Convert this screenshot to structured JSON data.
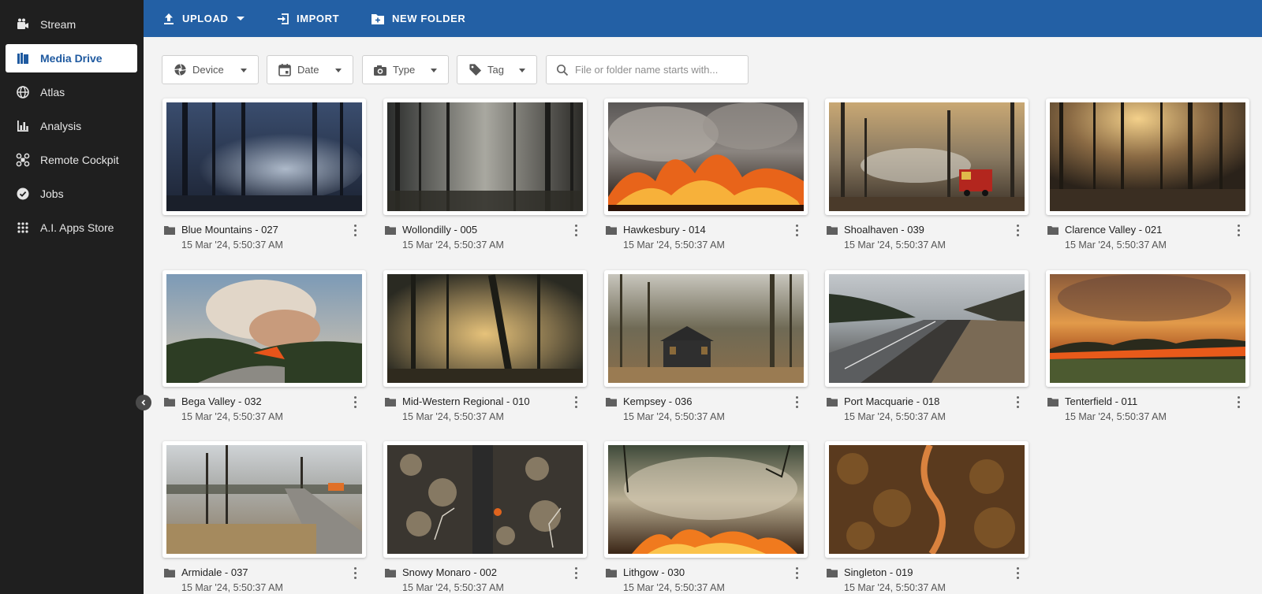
{
  "sidebar": {
    "items": [
      {
        "label": "Stream",
        "icon": "video-camera-icon",
        "active": false
      },
      {
        "label": "Media Drive",
        "icon": "media-library-icon",
        "active": true
      },
      {
        "label": "Atlas",
        "icon": "globe-icon",
        "active": false
      },
      {
        "label": "Analysis",
        "icon": "bar-chart-icon",
        "active": false
      },
      {
        "label": "Remote Cockpit",
        "icon": "drone-icon",
        "active": false
      },
      {
        "label": "Jobs",
        "icon": "check-circle-icon",
        "active": false
      },
      {
        "label": "A.I. Apps Store",
        "icon": "apps-grid-icon",
        "active": false
      }
    ]
  },
  "toolbar": {
    "upload_label": "UPLOAD",
    "import_label": "IMPORT",
    "new_folder_label": "NEW FOLDER"
  },
  "filters": {
    "device_label": "Device",
    "date_label": "Date",
    "type_label": "Type",
    "tag_label": "Tag"
  },
  "search": {
    "placeholder": "File or folder name starts with...",
    "value": ""
  },
  "colors": {
    "accent": "#2360a5",
    "sidebar_bg": "#1f1f1f",
    "active_text": "#1f5aa0"
  },
  "folders": [
    {
      "name": "Blue Mountains - 027",
      "date": "15 Mar '24, 5:50:37 AM",
      "scene": "blue-smoke-forest"
    },
    {
      "name": "Wollondilly - 005",
      "date": "15 Mar '24, 5:50:37 AM",
      "scene": "grey-smoke-forest"
    },
    {
      "name": "Hawkesbury - 014",
      "date": "15 Mar '24, 5:50:37 AM",
      "scene": "intense-fire"
    },
    {
      "name": "Shoalhaven - 039",
      "date": "15 Mar '24, 5:50:37 AM",
      "scene": "fire-truck-forest"
    },
    {
      "name": "Clarence Valley - 021",
      "date": "15 Mar '24, 5:50:37 AM",
      "scene": "sunlit-burnt-forest"
    },
    {
      "name": "Bega Valley - 032",
      "date": "15 Mar '24, 5:50:37 AM",
      "scene": "smoke-plume-valley"
    },
    {
      "name": "Mid-Western Regional - 010",
      "date": "15 Mar '24, 5:50:37 AM",
      "scene": "golden-smoke-forest"
    },
    {
      "name": "Kempsey - 036",
      "date": "15 Mar '24, 5:50:37 AM",
      "scene": "cabin-in-forest"
    },
    {
      "name": "Port Macquarie - 018",
      "date": "15 Mar '24, 5:50:37 AM",
      "scene": "burnt-road"
    },
    {
      "name": "Tenterfield - 011",
      "date": "15 Mar '24, 5:50:37 AM",
      "scene": "fire-front-treeline"
    },
    {
      "name": "Armidale - 037",
      "date": "15 Mar '24, 5:50:37 AM",
      "scene": "dirt-road-fire"
    },
    {
      "name": "Snowy Monaro - 002",
      "date": "15 Mar '24, 5:50:37 AM",
      "scene": "aerial-burnt-forest"
    },
    {
      "name": "Lithgow - 030",
      "date": "15 Mar '24, 5:50:37 AM",
      "scene": "flames-smoke"
    },
    {
      "name": "Singleton - 019",
      "date": "15 Mar '24, 5:50:37 AM",
      "scene": "aerial-orange-track"
    }
  ]
}
